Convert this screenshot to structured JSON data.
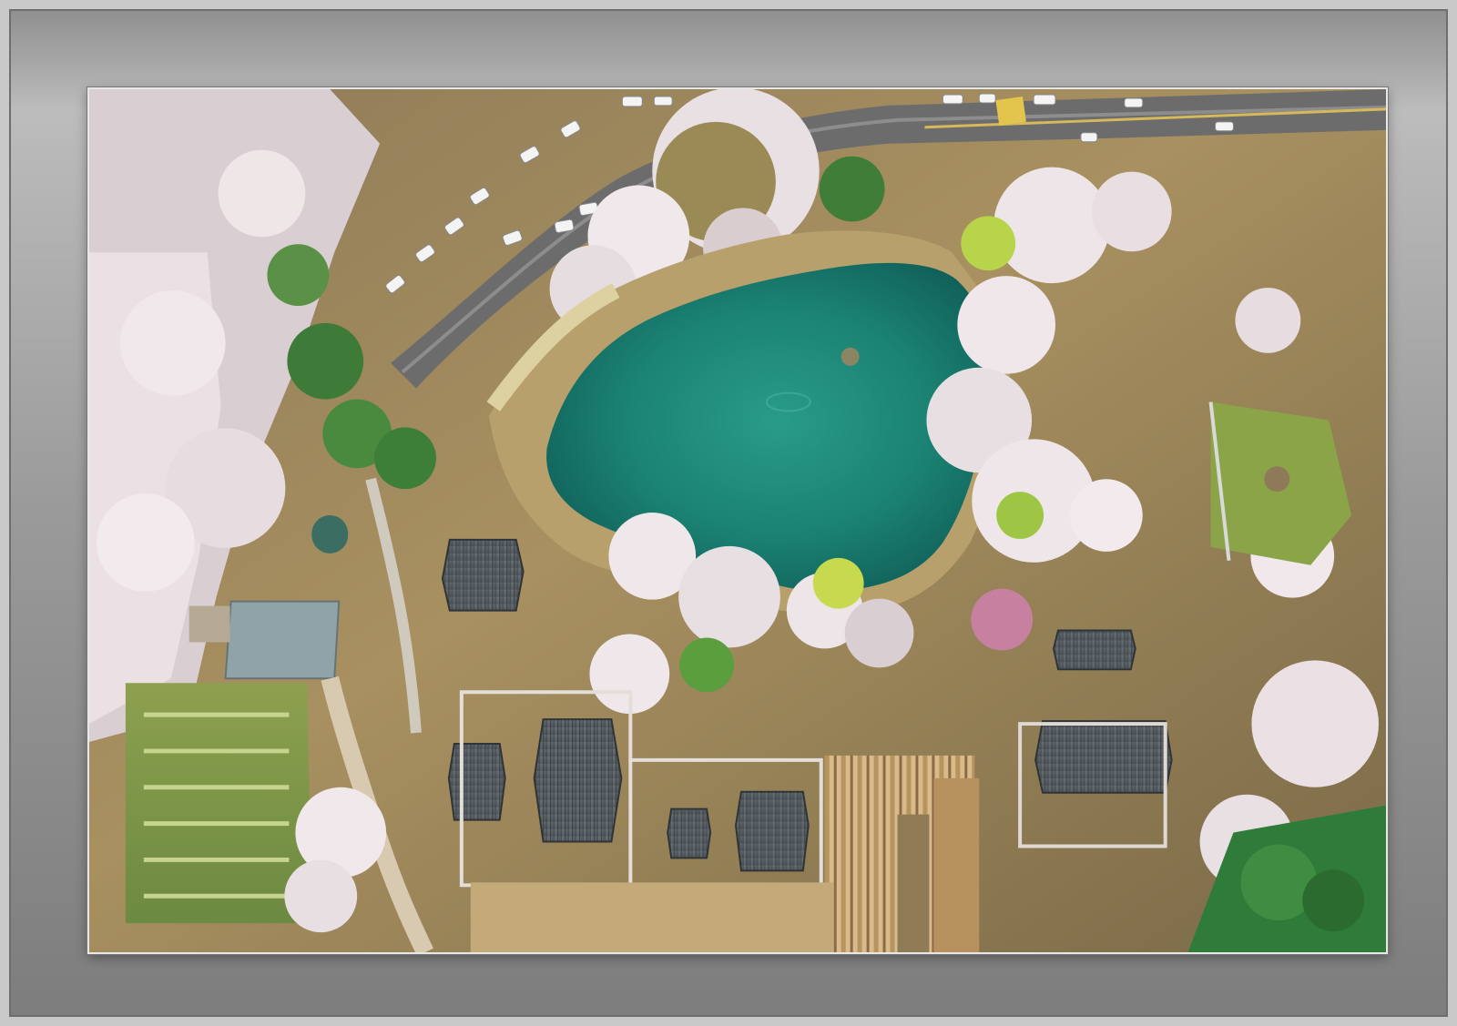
{
  "scene": {
    "type": "aerial-photograph",
    "elements": [
      "pond",
      "road",
      "parked-cars",
      "cherry-blossom-trees",
      "traditional-buildings",
      "farm-fields",
      "grassy-mound"
    ]
  },
  "colors": {
    "frame_light": "#c9c9c9",
    "frame_mid": "#9a9a9a",
    "frame_dark": "#7d7d7d",
    "photo_border": "#e8e8e8",
    "water": "#1f8a7b",
    "road": "#6f6f6f",
    "blossom": "#efe2e4",
    "tree_green": "#4d8f3e",
    "tile_roof": "#5d6468",
    "earth": "#b89c73"
  }
}
